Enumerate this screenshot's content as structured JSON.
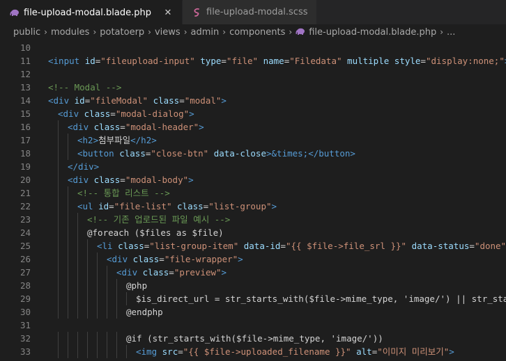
{
  "tabs": [
    {
      "label": "file-upload-modal.blade.php",
      "icon": "blade-elephant-icon",
      "active": true
    },
    {
      "label": "file-upload-modal.scss",
      "icon": "sass-icon",
      "active": false
    }
  ],
  "breadcrumb": [
    "public",
    "modules",
    "potatoerp",
    "views",
    "admin",
    "components",
    "file-upload-modal.blade.php",
    "..."
  ],
  "colors": {
    "tag": "#569cd6",
    "attr": "#9cdcfe",
    "string": "#ce9178",
    "comment": "#6a9955",
    "text": "#d4d4d4",
    "line_number": "#858585"
  },
  "lines": [
    {
      "n": "10",
      "indent": 0,
      "tokens": []
    },
    {
      "n": "11",
      "indent": 0,
      "tokens": [
        [
          "tag",
          "<input "
        ],
        [
          "attr",
          "id"
        ],
        [
          "txt",
          "="
        ],
        [
          "str",
          "\"fileupload-input\""
        ],
        [
          "txt",
          " "
        ],
        [
          "attr",
          "type"
        ],
        [
          "txt",
          "="
        ],
        [
          "str",
          "\"file\""
        ],
        [
          "txt",
          " "
        ],
        [
          "attr",
          "name"
        ],
        [
          "txt",
          "="
        ],
        [
          "str",
          "\"Filedata\""
        ],
        [
          "txt",
          " "
        ],
        [
          "attr",
          "multiple"
        ],
        [
          "txt",
          " "
        ],
        [
          "attr",
          "style"
        ],
        [
          "txt",
          "="
        ],
        [
          "str",
          "\"display:none;\""
        ],
        [
          "tag",
          ">"
        ]
      ]
    },
    {
      "n": "12",
      "indent": 0,
      "tokens": []
    },
    {
      "n": "13",
      "indent": 0,
      "tokens": [
        [
          "cmt",
          "<!-- Modal -->"
        ]
      ]
    },
    {
      "n": "14",
      "indent": 0,
      "tokens": [
        [
          "tag",
          "<div "
        ],
        [
          "attr",
          "id"
        ],
        [
          "txt",
          "="
        ],
        [
          "str",
          "\"fileModal\""
        ],
        [
          "txt",
          " "
        ],
        [
          "attr",
          "class"
        ],
        [
          "txt",
          "="
        ],
        [
          "str",
          "\"modal\""
        ],
        [
          "tag",
          ">"
        ]
      ]
    },
    {
      "n": "15",
      "indent": 1,
      "tokens": [
        [
          "tag",
          "<div "
        ],
        [
          "attr",
          "class"
        ],
        [
          "txt",
          "="
        ],
        [
          "str",
          "\"modal-dialog\""
        ],
        [
          "tag",
          ">"
        ]
      ]
    },
    {
      "n": "16",
      "indent": 2,
      "tokens": [
        [
          "tag",
          "<div "
        ],
        [
          "attr",
          "class"
        ],
        [
          "txt",
          "="
        ],
        [
          "str",
          "\"modal-header\""
        ],
        [
          "tag",
          ">"
        ]
      ]
    },
    {
      "n": "17",
      "indent": 3,
      "tokens": [
        [
          "tag",
          "<h2>"
        ],
        [
          "txt",
          "첨부파일"
        ],
        [
          "tag",
          "</h2>"
        ]
      ]
    },
    {
      "n": "18",
      "indent": 3,
      "tokens": [
        [
          "tag",
          "<button "
        ],
        [
          "attr",
          "class"
        ],
        [
          "txt",
          "="
        ],
        [
          "str",
          "\"close-btn\""
        ],
        [
          "txt",
          " "
        ],
        [
          "attr",
          "data-close"
        ],
        [
          "tag",
          ">"
        ],
        [
          "ent",
          "&times;"
        ],
        [
          "tag",
          "</button>"
        ]
      ]
    },
    {
      "n": "19",
      "indent": 2,
      "tokens": [
        [
          "tag",
          "</div>"
        ]
      ]
    },
    {
      "n": "20",
      "indent": 2,
      "tokens": [
        [
          "tag",
          "<div "
        ],
        [
          "attr",
          "class"
        ],
        [
          "txt",
          "="
        ],
        [
          "str",
          "\"modal-body\""
        ],
        [
          "tag",
          ">"
        ]
      ]
    },
    {
      "n": "21",
      "indent": 3,
      "tokens": [
        [
          "cmt",
          "<!-- 통합 리스트 -->"
        ]
      ]
    },
    {
      "n": "22",
      "indent": 3,
      "tokens": [
        [
          "tag",
          "<ul "
        ],
        [
          "attr",
          "id"
        ],
        [
          "txt",
          "="
        ],
        [
          "str",
          "\"file-list\""
        ],
        [
          "txt",
          " "
        ],
        [
          "attr",
          "class"
        ],
        [
          "txt",
          "="
        ],
        [
          "str",
          "\"list-group\""
        ],
        [
          "tag",
          ">"
        ]
      ]
    },
    {
      "n": "23",
      "indent": 4,
      "tokens": [
        [
          "cmt",
          "<!-- 기존 업로드된 파일 예시 -->"
        ]
      ]
    },
    {
      "n": "24",
      "indent": 4,
      "tokens": [
        [
          "txt",
          "@foreach ($files as $file)"
        ]
      ]
    },
    {
      "n": "25",
      "indent": 5,
      "tokens": [
        [
          "tag",
          "<li "
        ],
        [
          "attr",
          "class"
        ],
        [
          "txt",
          "="
        ],
        [
          "str",
          "\"list-group-item\""
        ],
        [
          "txt",
          " "
        ],
        [
          "attr",
          "data-id"
        ],
        [
          "txt",
          "="
        ],
        [
          "str",
          "\"{{ $file->file_srl }}\""
        ],
        [
          "txt",
          " "
        ],
        [
          "attr",
          "data-status"
        ],
        [
          "txt",
          "="
        ],
        [
          "str",
          "\"done\""
        ],
        [
          "tag",
          ">"
        ]
      ]
    },
    {
      "n": "26",
      "indent": 6,
      "tokens": [
        [
          "tag",
          "<div "
        ],
        [
          "attr",
          "class"
        ],
        [
          "txt",
          "="
        ],
        [
          "str",
          "\"file-wrapper\""
        ],
        [
          "tag",
          ">"
        ]
      ]
    },
    {
      "n": "27",
      "indent": 7,
      "tokens": [
        [
          "tag",
          "<div "
        ],
        [
          "attr",
          "class"
        ],
        [
          "txt",
          "="
        ],
        [
          "str",
          "\"preview\""
        ],
        [
          "tag",
          ">"
        ]
      ]
    },
    {
      "n": "28",
      "indent": 8,
      "tokens": [
        [
          "txt",
          "@php"
        ]
      ]
    },
    {
      "n": "29",
      "indent": 9,
      "tokens": [
        [
          "txt",
          "$is_direct_url = str_starts_with($file->mime_type, 'image/') || str_starts_w"
        ]
      ]
    },
    {
      "n": "30",
      "indent": 8,
      "tokens": [
        [
          "txt",
          "@endphp"
        ]
      ]
    },
    {
      "n": "31",
      "indent": 0,
      "tokens": []
    },
    {
      "n": "32",
      "indent": 8,
      "tokens": [
        [
          "txt",
          "@if (str_starts_with($file->mime_type, 'image/'))"
        ]
      ]
    },
    {
      "n": "33",
      "indent": 9,
      "tokens": [
        [
          "tag",
          "<img "
        ],
        [
          "attr",
          "src"
        ],
        [
          "txt",
          "="
        ],
        [
          "str",
          "\"{{ $file->uploaded_filename }}\""
        ],
        [
          "txt",
          " "
        ],
        [
          "attr",
          "alt"
        ],
        [
          "txt",
          "="
        ],
        [
          "str",
          "\"이미지 미리보기\""
        ],
        [
          "tag",
          ">"
        ]
      ]
    }
  ]
}
